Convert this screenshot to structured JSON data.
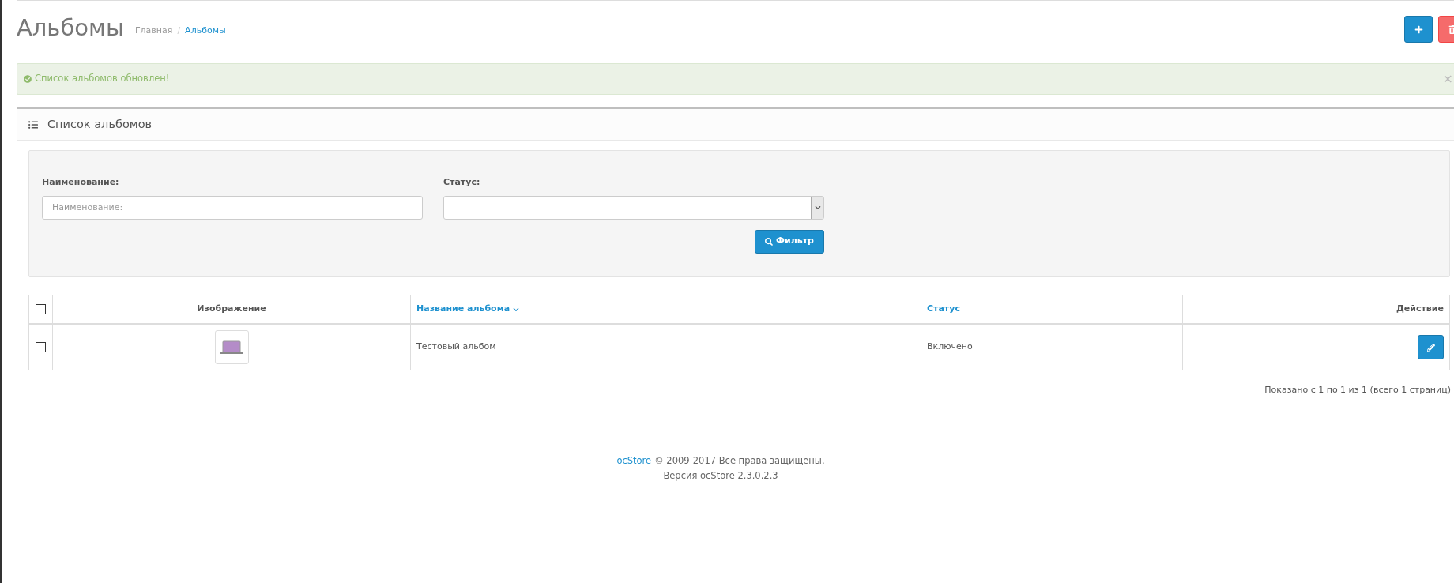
{
  "page_title": "Альбомы",
  "breadcrumbs": [
    {
      "label": "Главная",
      "current": false
    },
    {
      "separator": "/",
      "label": "Альбомы",
      "current": true
    }
  ],
  "alert": {
    "message": "Список альбомов обновлен!",
    "close": "×"
  },
  "panel": {
    "title": "Список альбомов",
    "filters": [
      {
        "label": "Наименование:",
        "kind": "text",
        "placeholder": "Наименование:"
      },
      {
        "label": "Статус:",
        "kind": "select"
      }
    ],
    "filter_button": "Фильтр",
    "table": {
      "select_all_checked": false,
      "columns": [
        {
          "label": "Изображение",
          "sortable": false
        },
        {
          "label": "Название альбома",
          "sortable": true,
          "sorted": true
        },
        {
          "label": "Статус",
          "sortable": true,
          "sorted": false
        },
        {
          "label": "Действие",
          "sortable": false
        }
      ],
      "rows": [
        {
          "checked": false,
          "name": "Тестовый альбом",
          "status": "Включено"
        }
      ]
    },
    "pagination": "Показано с 1 по 1 из 1 (всего 1 страниц)"
  },
  "footer": {
    "brand": "ocStore",
    "copyright": "© 2009-2017 Все права защищены.",
    "version": "Версия ocStore 2.3.0.2.3"
  }
}
